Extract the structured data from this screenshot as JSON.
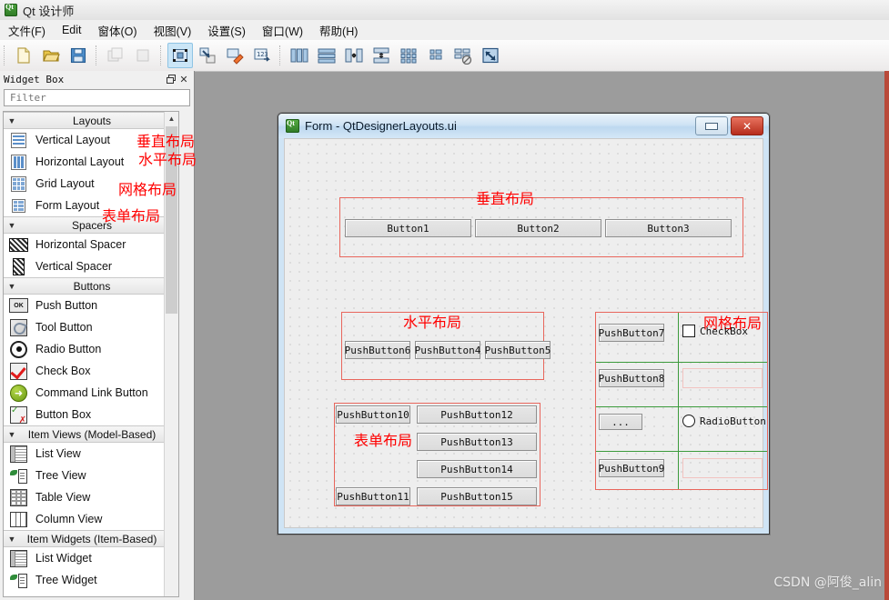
{
  "window": {
    "app_icon": "qt-logo-icon",
    "title": "Qt 设计师"
  },
  "menubar": {
    "items": [
      {
        "label": "文件(F)",
        "name": "menu-file"
      },
      {
        "label": "Edit",
        "name": "menu-edit"
      },
      {
        "label": "窗体(O)",
        "name": "menu-form"
      },
      {
        "label": "视图(V)",
        "name": "menu-view"
      },
      {
        "label": "设置(S)",
        "name": "menu-settings"
      },
      {
        "label": "窗口(W)",
        "name": "menu-window"
      },
      {
        "label": "帮助(H)",
        "name": "menu-help"
      }
    ]
  },
  "toolbar": {
    "groups": [
      {
        "buttons": [
          {
            "name": "new-form-icon",
            "state": "normal"
          },
          {
            "name": "open-folder-icon",
            "state": "normal"
          },
          {
            "name": "save-icon",
            "state": "normal"
          }
        ]
      },
      {
        "buttons": [
          {
            "name": "undo-icon",
            "state": "disabled"
          },
          {
            "name": "redo-icon",
            "state": "disabled"
          }
        ]
      },
      {
        "buttons": [
          {
            "name": "edit-widgets-icon",
            "state": "active"
          },
          {
            "name": "edit-signals-slots-icon",
            "state": "normal"
          },
          {
            "name": "edit-buddies-icon",
            "state": "normal"
          },
          {
            "name": "edit-tab-order-icon",
            "state": "normal"
          }
        ]
      },
      {
        "buttons": [
          {
            "name": "layout-horizontally-icon",
            "state": "normal"
          },
          {
            "name": "layout-vertically-icon",
            "state": "normal"
          },
          {
            "name": "layout-splitter-horizontal-icon",
            "state": "normal"
          },
          {
            "name": "layout-splitter-vertical-icon",
            "state": "normal"
          },
          {
            "name": "layout-grid-icon",
            "state": "normal"
          },
          {
            "name": "layout-form-icon",
            "state": "normal"
          },
          {
            "name": "break-layout-icon",
            "state": "normal"
          },
          {
            "name": "adjust-size-icon",
            "state": "normal"
          }
        ]
      }
    ]
  },
  "widget_box": {
    "title": "Widget Box",
    "restore_icon": "restore-icon",
    "close_icon": "close-icon",
    "filter_placeholder": "Filter",
    "filter_value": "",
    "scroll": {
      "up_arrow": "chevron-up-icon"
    },
    "groups": [
      {
        "name": "Layouts",
        "collapse_icon": "chevron-down-icon",
        "items": [
          {
            "label": "Vertical Layout",
            "icon": "vertical-layout-icon"
          },
          {
            "label": "Horizontal Layout",
            "icon": "horizontal-layout-icon"
          },
          {
            "label": "Grid Layout",
            "icon": "grid-layout-icon"
          },
          {
            "label": "Form Layout",
            "icon": "form-layout-icon"
          }
        ]
      },
      {
        "name": "Spacers",
        "collapse_icon": "chevron-down-icon",
        "items": [
          {
            "label": "Horizontal Spacer",
            "icon": "horizontal-spacer-icon"
          },
          {
            "label": "Vertical Spacer",
            "icon": "vertical-spacer-icon"
          }
        ]
      },
      {
        "name": "Buttons",
        "collapse_icon": "chevron-down-icon",
        "items": [
          {
            "label": "Push Button",
            "icon": "push-button-icon"
          },
          {
            "label": "Tool Button",
            "icon": "tool-button-icon"
          },
          {
            "label": "Radio Button",
            "icon": "radio-button-icon"
          },
          {
            "label": "Check Box",
            "icon": "check-box-icon"
          },
          {
            "label": "Command Link Button",
            "icon": "command-link-button-icon"
          },
          {
            "label": "Button Box",
            "icon": "button-box-icon"
          }
        ]
      },
      {
        "name": "Item Views (Model-Based)",
        "collapse_icon": "chevron-down-icon",
        "items": [
          {
            "label": "List View",
            "icon": "list-view-icon"
          },
          {
            "label": "Tree View",
            "icon": "tree-view-icon"
          },
          {
            "label": "Table View",
            "icon": "table-view-icon"
          },
          {
            "label": "Column View",
            "icon": "column-view-icon"
          }
        ]
      },
      {
        "name": "Item Widgets (Item-Based)",
        "collapse_icon": "chevron-down-icon",
        "items": [
          {
            "label": "List Widget",
            "icon": "list-widget-icon"
          },
          {
            "label": "Tree Widget",
            "icon": "tree-widget-icon"
          }
        ]
      }
    ]
  },
  "sidebar_annotations": [
    {
      "text": "垂直布局",
      "meaning": "vertical-layout"
    },
    {
      "text": "水平布局",
      "meaning": "horizontal-layout"
    },
    {
      "text": "网格布局",
      "meaning": "grid-layout"
    },
    {
      "text": "表单布局",
      "meaning": "form-layout"
    }
  ],
  "form_window": {
    "icon": "qt-logo-icon",
    "title": "Form - QtDesignerLayouts.ui",
    "minimize_label": "",
    "close_label": "✕",
    "annotations": [
      {
        "text": "垂直布局",
        "name": "anno-vertical-layout"
      },
      {
        "text": "水平布局",
        "name": "anno-horizontal-layout"
      },
      {
        "text": "网格布局",
        "name": "anno-grid-layout"
      },
      {
        "text": "表单布局",
        "name": "anno-form-layout"
      }
    ],
    "vertical_layout_group": {
      "buttons": [
        "Button1",
        "Button2",
        "Button3"
      ]
    },
    "horizontal_layout_group": {
      "buttons": [
        "PushButton6",
        "PushButton4",
        "PushButton5"
      ]
    },
    "form_layout_group": {
      "buttons": [
        "PushButton10",
        "PushButton12",
        "PushButton13",
        "PushButton14",
        "PushButton11",
        "PushButton15"
      ]
    },
    "grid_layout_group": {
      "buttons": [
        "PushButton7",
        "PushButton8",
        "...",
        "PushButton9"
      ],
      "checkbox_label": "CheckBox",
      "radio_label": "RadioButton"
    }
  },
  "watermark": "CSDN @阿俊_alin",
  "colors": {
    "workspace_bg": "#9c9c9c",
    "annotation_red": "#ff0000",
    "layout_box_red": "#e8665c",
    "grid_guide_green": "#3c9b3c",
    "active_toolbtn": "#cbe6f7"
  }
}
